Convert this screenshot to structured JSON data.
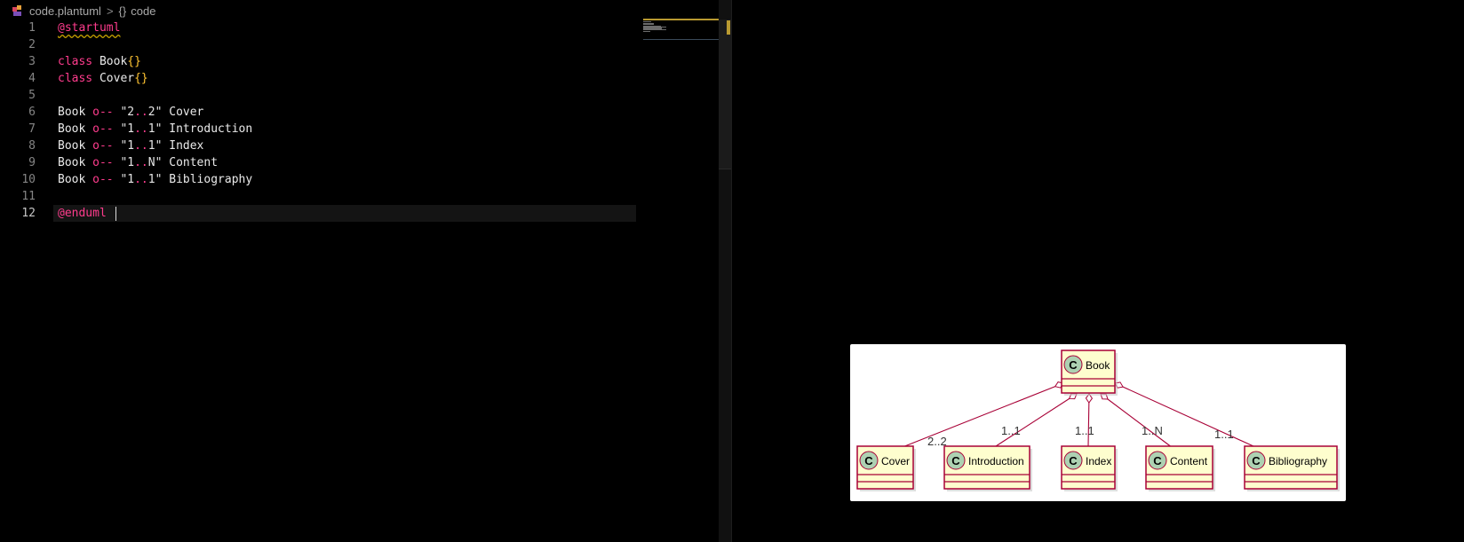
{
  "breadcrumb": {
    "file_name": "code.plantuml",
    "separator": ">",
    "symbol_icon": "{}",
    "symbol_name": "code"
  },
  "code": {
    "lines": [
      {
        "num": "1"
      },
      {
        "num": "2"
      },
      {
        "num": "3"
      },
      {
        "num": "4"
      },
      {
        "num": "5"
      },
      {
        "num": "6"
      },
      {
        "num": "7"
      },
      {
        "num": "8"
      },
      {
        "num": "9"
      },
      {
        "num": "10"
      },
      {
        "num": "11"
      },
      {
        "num": "12"
      }
    ],
    "tokens": {
      "startuml": "@startuml",
      "enduml": "@enduml",
      "class_kw": "class",
      "book": "Book",
      "cover": "Cover",
      "braces": "{}",
      "arrow": "o--",
      "rel1_from": "2",
      "rel1_to": "2",
      "rel1_target": "Cover",
      "rel2_from": "1",
      "rel2_to": "1",
      "rel2_target": "Introduction",
      "rel3_from": "1",
      "rel3_to": "1",
      "rel3_target": "Index",
      "rel4_from": "1",
      "rel4_to": "N",
      "rel4_target": "Content",
      "rel5_from": "1",
      "rel5_to": "1",
      "rel5_target": "Bibliography",
      "dots": ".."
    }
  },
  "diagram": {
    "class_marker": "C",
    "root": "Book",
    "children": [
      {
        "name": "Cover",
        "multiplicity": "2..2"
      },
      {
        "name": "Introduction",
        "multiplicity": "1..1"
      },
      {
        "name": "Index",
        "multiplicity": "1..1"
      },
      {
        "name": "Content",
        "multiplicity": "1..N"
      },
      {
        "name": "Bibliography",
        "multiplicity": "1..1"
      }
    ]
  },
  "colors": {
    "keyword": "#ff3c8d",
    "brace": "#ffc431",
    "class_fill": "#fefece",
    "class_border": "#a80036",
    "class_marker_fill": "#add1b2"
  }
}
